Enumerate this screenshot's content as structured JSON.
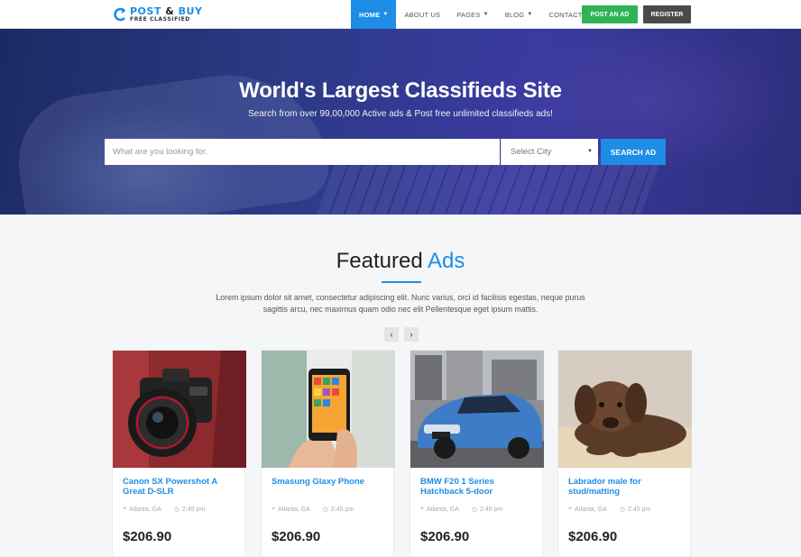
{
  "brand": {
    "line1_a": "POST",
    "line1_amp": "&",
    "line1_b": "BUY",
    "line2": "FREE CLASSIFIED"
  },
  "nav": {
    "items": [
      {
        "label": "HOME",
        "caret": "▼"
      },
      {
        "label": "ABOUT US"
      },
      {
        "label": "PAGES",
        "caret": "▼"
      },
      {
        "label": "BLOG",
        "caret": "▼"
      },
      {
        "label": "CONTACT"
      }
    ],
    "post_ad": "POST AN AD",
    "register": "REGISTER"
  },
  "hero": {
    "title": "World's Largest Classifieds Site",
    "subtitle": "Search from over 99,00,000 Active ads & Post free unlimited classifieds ads!",
    "search_placeholder": "What are you looking for.",
    "city_select": "Select City",
    "search_button": "SEARCH AD"
  },
  "featured": {
    "title_main": "Featured",
    "title_accent": "Ads",
    "description": "Lorem ipsum dolor sit amet, consectetur adipiscing elit. Nunc varius, orci id facilisis egestas, neque purus sagittis arcu, nec maximus quam odio nec elit Pellentesque eget ipsum mattis.",
    "prev": "‹",
    "next": "›"
  },
  "cards": [
    {
      "title": "Canon SX Powershot A Great D-SLR",
      "location": "Atlanta, GA",
      "time": "2:45 pm",
      "price": "$206.90",
      "image": "camera"
    },
    {
      "title": "Smasung Glaxy Phone",
      "location": "Atlanta, GA",
      "time": "2:45 pm",
      "price": "$206.90",
      "image": "phone"
    },
    {
      "title": "BMW F20 1 Series Hatchback 5-door",
      "location": "Atlanta, GA",
      "time": "2:45 pm",
      "price": "$206.90",
      "image": "car"
    },
    {
      "title": "Labrador male for stud/matting",
      "location": "Atlanta, GA",
      "time": "2:45 pm",
      "price": "$206.90",
      "image": "dog"
    }
  ],
  "colors": {
    "accent": "#1e8de6",
    "post_ad": "#2fb455",
    "register": "#4a4a4a"
  }
}
